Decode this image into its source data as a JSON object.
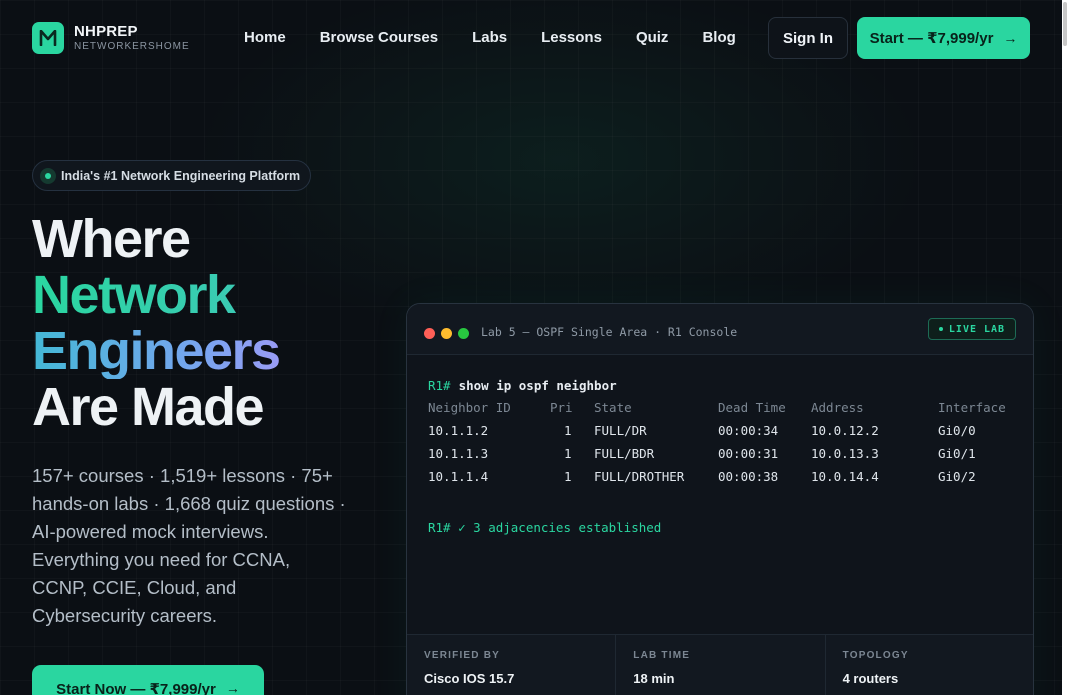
{
  "brand": {
    "name": "NHPREP",
    "tagline": "NETWORKERSHOME",
    "logo_letter": "M",
    "accent": "#2ad6a0"
  },
  "nav": {
    "links": [
      "Home",
      "Browse Courses",
      "Labs",
      "Lessons",
      "Quiz",
      "Blog"
    ],
    "signin_label": "Sign In",
    "start_label": "Start — ₹7,999/yr"
  },
  "hero": {
    "badge": "India's #1 Network Engineering Platform",
    "headline": [
      "Where",
      "Network",
      "Engineers",
      "Are Made"
    ],
    "description": "157+ courses · 1,519+ lessons · 75+ hands-on labs · 1,668 quiz questions · AI-powered mock interviews. Everything you need for CCNA, CCNP, CCIE, Cloud, and Cybersecurity careers.",
    "cta_label": "Start Now — ₹7,999/yr"
  },
  "terminal": {
    "title": "Lab 5 — OSPF Single Area · R1 Console",
    "live_badge": "LIVE LAB",
    "prompt": "R1#",
    "command": "show ip ospf neighbor",
    "columns": [
      "Neighbor ID",
      "Pri",
      "State",
      "Dead Time",
      "Address",
      "Interface"
    ],
    "rows": [
      [
        "10.1.1.2",
        "1",
        "FULL/DR",
        "00:00:34",
        "10.0.12.2",
        "Gi0/0"
      ],
      [
        "10.1.1.3",
        "1",
        "FULL/BDR",
        "00:00:31",
        "10.0.13.3",
        "Gi0/1"
      ],
      [
        "10.1.1.4",
        "1",
        "FULL/DROTHER",
        "00:00:38",
        "10.0.14.4",
        "Gi0/2"
      ]
    ],
    "result": "R1# ✓ 3 adjacencies established",
    "window_dot_colors": [
      "#ff5f57",
      "#febc2e",
      "#28c840"
    ],
    "footer": [
      {
        "label": "VERIFIED BY",
        "value": "Cisco IOS 15.7"
      },
      {
        "label": "LAB TIME",
        "value": "18 min"
      },
      {
        "label": "TOPOLOGY",
        "value": "4 routers"
      }
    ]
  }
}
